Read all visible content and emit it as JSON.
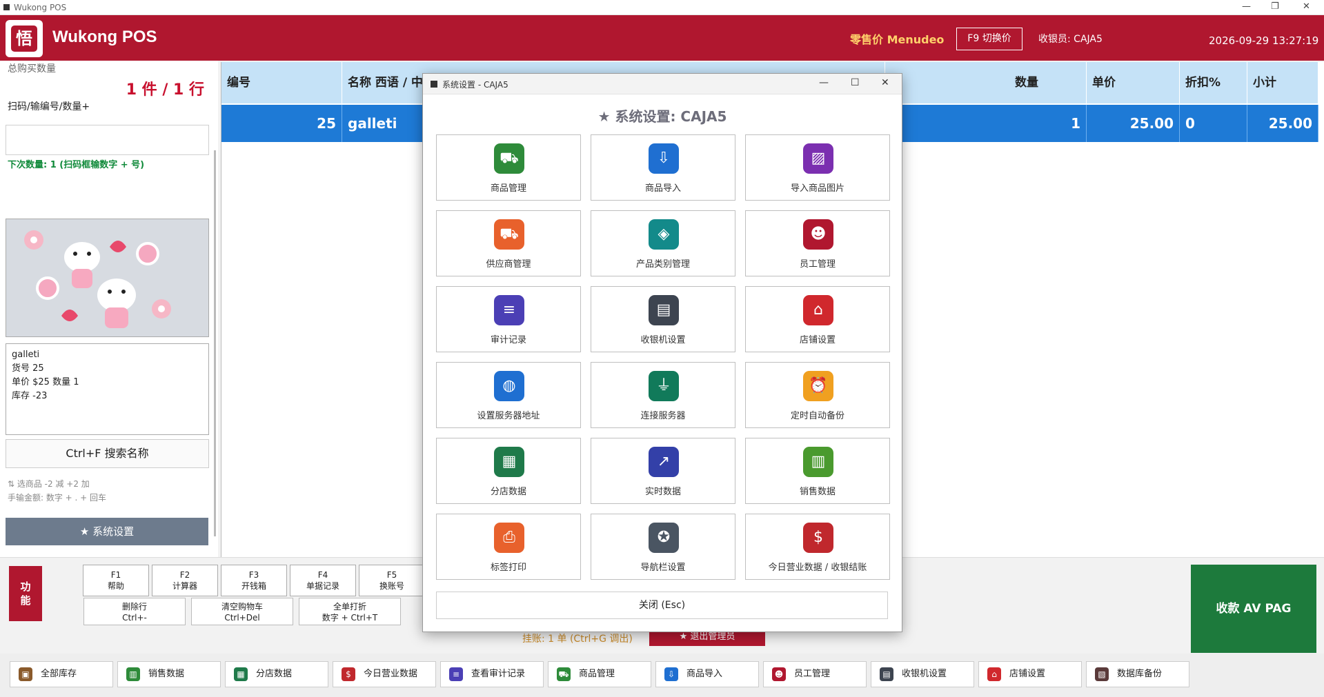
{
  "window": {
    "title": "Wukong POS",
    "controls": [
      "—",
      "❐",
      "✕"
    ]
  },
  "header": {
    "logo_char": "悟",
    "app_name": "Wukong POS",
    "price_mode": "零售价 Menudeo",
    "switch_price": "F9 切换价",
    "cashier": "收银员: CAJA5",
    "datetime": "2026-09-29 13:27:19"
  },
  "left": {
    "total_label": "总购买数量",
    "count": "1 件 / 1 行",
    "scan_label": "扫码/输编号/数量+",
    "scan_value": "",
    "next_qty": "下次数量: 1   (扫码框输数字 + 号)",
    "product_info": {
      "name": "galleti",
      "code": "货号 25",
      "price_qty": "单价 $25    数量 1",
      "stock": "库存 -23"
    },
    "search_button": "Ctrl+F 搜索名称",
    "hint1": "⇅ 选商品   -2 减   +2 加",
    "hint2": "手输金额: 数字 + . + 回车",
    "settings_button": "★ 系统设置"
  },
  "table": {
    "columns": [
      "编号",
      "名称 西语 / 中文",
      "数量",
      "单价",
      "折扣%",
      "小计"
    ],
    "rows": [
      {
        "code": "25",
        "name": "galleti",
        "qty": "1",
        "price": "25.00",
        "discount": "0",
        "subtotal": "25.00"
      }
    ]
  },
  "function_bar": {
    "label": "功\n能",
    "fkeys": [
      {
        "key": "F1",
        "label": "帮助"
      },
      {
        "key": "F2",
        "label": "计算器"
      },
      {
        "key": "F3",
        "label": "开钱箱"
      },
      {
        "key": "F4",
        "label": "单据记录"
      },
      {
        "key": "F5",
        "label": "换账号"
      }
    ],
    "actions": [
      {
        "label": "删除行",
        "shortcut": "Ctrl+-"
      },
      {
        "label": "清空购物车",
        "shortcut": "Ctrl+Del"
      },
      {
        "label": "全单打折",
        "shortcut": "数字 + Ctrl+T"
      }
    ],
    "hold": "挂账: 1 单  (Ctrl+G 调出)",
    "exit_admin": "★ 退出管理员",
    "pay_button": "收款 AV PAG"
  },
  "bottom_bar": [
    {
      "label": "全部库存",
      "icon": "box-icon",
      "glyph": "▣",
      "color": "#8a5a2b"
    },
    {
      "label": "销售数据",
      "icon": "chart-icon",
      "glyph": "▥",
      "color": "#2e8b3a"
    },
    {
      "label": "分店数据",
      "icon": "grid-icon",
      "glyph": "▦",
      "color": "#1f7a4a"
    },
    {
      "label": "今日营业数据",
      "icon": "money-bag-icon",
      "glyph": "$",
      "color": "#c0282d"
    },
    {
      "label": "查看审计记录",
      "icon": "clipboard-icon",
      "glyph": "≡",
      "color": "#4b3fb5"
    },
    {
      "label": "商品管理",
      "icon": "cart-icon",
      "glyph": "⛟",
      "color": "#2e8b3a"
    },
    {
      "label": "商品导入",
      "icon": "import-icon",
      "glyph": "⇩",
      "color": "#1f6fd1"
    },
    {
      "label": "员工管理",
      "icon": "people-icon",
      "glyph": "☻",
      "color": "#b0172f"
    },
    {
      "label": "收银机设置",
      "icon": "register-icon",
      "glyph": "▤",
      "color": "#3d4450"
    },
    {
      "label": "店铺设置",
      "icon": "store-icon",
      "glyph": "⌂",
      "color": "#d0282d"
    },
    {
      "label": "数据库备份",
      "icon": "database-icon",
      "glyph": "▧",
      "color": "#5a3a3a"
    }
  ],
  "modal": {
    "window_title": "系统设置 - CAJA5",
    "heading": "★ 系统设置: CAJA5",
    "controls": [
      "—",
      "☐",
      "✕"
    ],
    "cards": [
      {
        "label": "商品管理",
        "icon": "cart-icon",
        "glyph": "⛟",
        "color": "#2e8b3a"
      },
      {
        "label": "商品导入",
        "icon": "import-icon",
        "glyph": "⇩",
        "color": "#1f6fd1"
      },
      {
        "label": "导入商品图片",
        "icon": "image-icon",
        "glyph": "▨",
        "color": "#7b2fb0"
      },
      {
        "label": "供应商管理",
        "icon": "truck-icon",
        "glyph": "⛟",
        "color": "#e8612c"
      },
      {
        "label": "产品类别管理",
        "icon": "tag-icon",
        "glyph": "◈",
        "color": "#138a8a"
      },
      {
        "label": "员工管理",
        "icon": "people-icon",
        "glyph": "☻",
        "color": "#b0172f"
      },
      {
        "label": "审计记录",
        "icon": "clipboard-icon",
        "glyph": "≡",
        "color": "#4b3fb5"
      },
      {
        "label": "收银机设置",
        "icon": "register-icon",
        "glyph": "▤",
        "color": "#3d4450"
      },
      {
        "label": "店铺设置",
        "icon": "store-icon",
        "glyph": "⌂",
        "color": "#d0282d"
      },
      {
        "label": "设置服务器地址",
        "icon": "globe-icon",
        "glyph": "◍",
        "color": "#1f6fd1"
      },
      {
        "label": "连接服务器",
        "icon": "plug-icon",
        "glyph": "⏚",
        "color": "#117a5a"
      },
      {
        "label": "定时自动备份",
        "icon": "alarm-icon",
        "glyph": "⏰",
        "color": "#f0a020"
      },
      {
        "label": "分店数据",
        "icon": "grid-icon",
        "glyph": "▦",
        "color": "#1f7a4a"
      },
      {
        "label": "实时数据",
        "icon": "line-chart-icon",
        "glyph": "↗",
        "color": "#3340a8"
      },
      {
        "label": "销售数据",
        "icon": "bar-chart-icon",
        "glyph": "▥",
        "color": "#4a9a2e"
      },
      {
        "label": "标签打印",
        "icon": "printer-icon",
        "glyph": "⎙",
        "color": "#e8612c"
      },
      {
        "label": "导航栏设置",
        "icon": "compass-icon",
        "glyph": "✪",
        "color": "#4a5562"
      },
      {
        "label": "今日营业数据 / 收银结账",
        "icon": "money-bag-icon",
        "glyph": "$",
        "color": "#c0282d"
      }
    ],
    "close_button": "关闭 (Esc)"
  }
}
